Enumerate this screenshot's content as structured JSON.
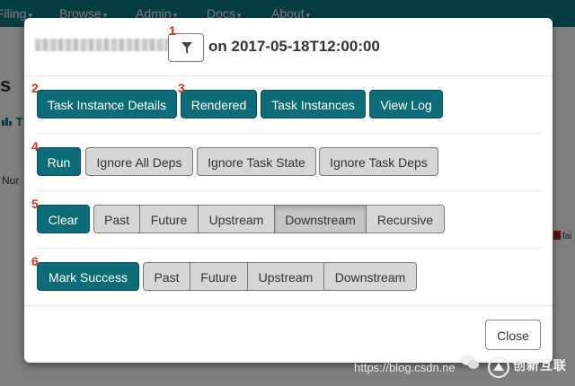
{
  "navbar": {
    "items": [
      "Filing",
      "Browse",
      "Admin",
      "Docs",
      "About"
    ]
  },
  "background": {
    "title_partial": "s",
    "chart_partial": "T",
    "num_partial": "Nur",
    "fail_partial": "fai"
  },
  "modal": {
    "title_suffix": "on 2017-05-18T12:00:00",
    "buttons": {
      "task_instance_details": "Task Instance Details",
      "rendered": "Rendered",
      "task_instances": "Task Instances",
      "view_log": "View Log",
      "run": "Run",
      "ignore_all_deps": "Ignore All Deps",
      "ignore_task_state": "Ignore Task State",
      "ignore_task_deps": "Ignore Task Deps",
      "clear": "Clear",
      "clear_options": [
        "Past",
        "Future",
        "Upstream",
        "Downstream",
        "Recursive"
      ],
      "mark_success": "Mark Success",
      "mark_success_options": [
        "Past",
        "Future",
        "Upstream",
        "Downstream"
      ],
      "close": "Close"
    },
    "markers": [
      "1",
      "2",
      "3",
      "4",
      "5",
      "6"
    ]
  },
  "watermark": {
    "url": "https://blog.csdn.ne",
    "brand": "创新互联"
  },
  "colors": {
    "navbar": "#0d7a86",
    "primary_button": "#0d6c77",
    "marker": "#d9321c"
  },
  "icons": [
    "filter-icon",
    "bar-chart-icon",
    "wechat-icon",
    "brand-logo-icon"
  ]
}
